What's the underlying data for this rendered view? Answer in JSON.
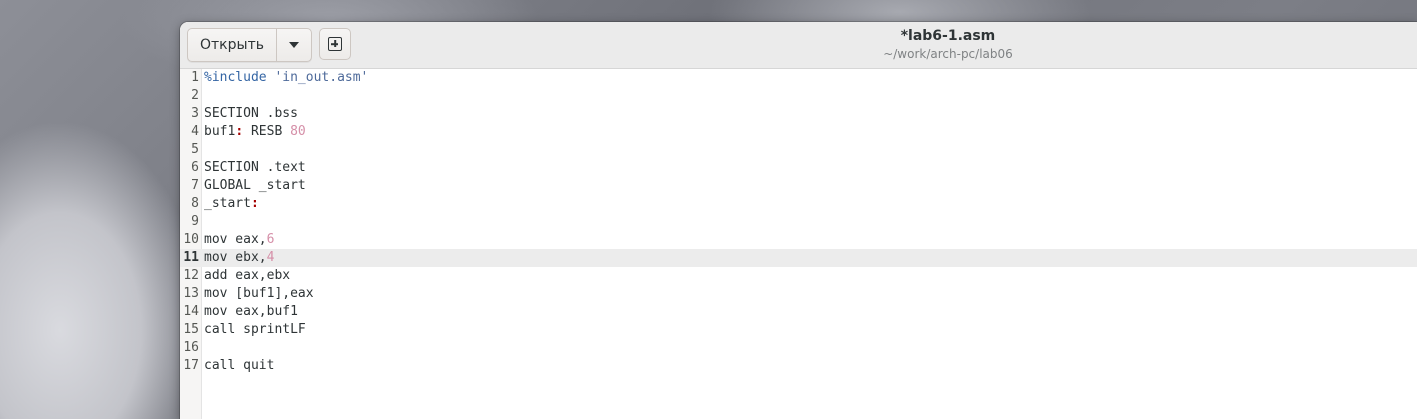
{
  "header": {
    "open_label": "Открыть",
    "title": "*lab6-1.asm",
    "subtitle": "~/work/arch-pc/lab06"
  },
  "editor": {
    "current_line": 11,
    "lines": [
      {
        "n": "1",
        "segments": [
          {
            "t": "%include ",
            "k": "pre"
          },
          {
            "t": "'in_out.asm'",
            "k": "str"
          }
        ]
      },
      {
        "n": "2",
        "segments": []
      },
      {
        "n": "3",
        "segments": [
          {
            "t": "SECTION .bss",
            "k": ""
          }
        ]
      },
      {
        "n": "4",
        "segments": [
          {
            "t": "buf1",
            "k": ""
          },
          {
            "t": ":",
            "k": "colon"
          },
          {
            "t": " RESB ",
            "k": ""
          },
          {
            "t": "80",
            "k": "num"
          }
        ]
      },
      {
        "n": "5",
        "segments": []
      },
      {
        "n": "6",
        "segments": [
          {
            "t": "SECTION .text",
            "k": ""
          }
        ]
      },
      {
        "n": "7",
        "segments": [
          {
            "t": "GLOBAL _start",
            "k": ""
          }
        ]
      },
      {
        "n": "8",
        "segments": [
          {
            "t": "_start",
            "k": ""
          },
          {
            "t": ":",
            "k": "colon"
          }
        ]
      },
      {
        "n": "9",
        "segments": []
      },
      {
        "n": "10",
        "segments": [
          {
            "t": "mov eax,",
            "k": ""
          },
          {
            "t": "6",
            "k": "num"
          }
        ]
      },
      {
        "n": "11",
        "segments": [
          {
            "t": "mov ebx,",
            "k": ""
          },
          {
            "t": "4",
            "k": "num"
          }
        ]
      },
      {
        "n": "12",
        "segments": [
          {
            "t": "add eax,ebx",
            "k": ""
          }
        ]
      },
      {
        "n": "13",
        "segments": [
          {
            "t": "mov [buf1],eax",
            "k": ""
          }
        ]
      },
      {
        "n": "14",
        "segments": [
          {
            "t": "mov eax,buf1",
            "k": ""
          }
        ]
      },
      {
        "n": "15",
        "segments": [
          {
            "t": "call sprintLF",
            "k": ""
          }
        ]
      },
      {
        "n": "16",
        "segments": []
      },
      {
        "n": "17",
        "segments": [
          {
            "t": "call quit",
            "k": ""
          }
        ]
      }
    ]
  }
}
